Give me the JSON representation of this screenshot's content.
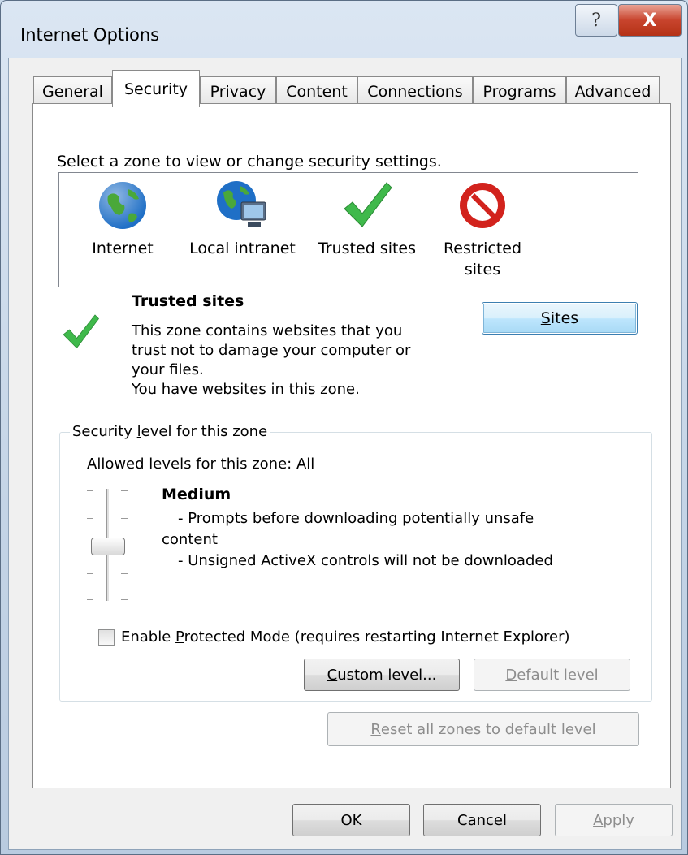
{
  "window": {
    "title": "Internet Options",
    "help_label": "?",
    "close_label": "X"
  },
  "tabs": [
    {
      "label": "General"
    },
    {
      "label": "Security"
    },
    {
      "label": "Privacy"
    },
    {
      "label": "Content"
    },
    {
      "label": "Connections"
    },
    {
      "label": "Programs"
    },
    {
      "label": "Advanced"
    }
  ],
  "active_tab": "Security",
  "zones": {
    "prompt": "Select a zone to view or change security settings.",
    "items": [
      {
        "label_line1": "Internet",
        "label_line2": "",
        "icon": "globe-icon"
      },
      {
        "label_line1": "Local intranet",
        "label_line2": "",
        "icon": "intranet-globe-icon"
      },
      {
        "label_line1": "Trusted sites",
        "label_line2": "",
        "icon": "checkmark-icon"
      },
      {
        "label_line1": "Restricted",
        "label_line2": "sites",
        "icon": "no-entry-icon"
      }
    ]
  },
  "selected_zone": {
    "title": "Trusted sites",
    "desc_line1": "This zone contains websites that you",
    "desc_line2": "trust not to damage your computer or",
    "desc_line3": "your files.",
    "desc_line4": "You have websites in this zone.",
    "sites_button": {
      "prefix": "",
      "underlined": "S",
      "rest": "ites"
    }
  },
  "security_level": {
    "group_title_pre": "Security ",
    "group_title_underlined": "l",
    "group_title_post": "evel for this zone",
    "allowed": "Allowed levels for this zone: All",
    "level_name": "Medium",
    "desc_line1": "- Prompts before downloading potentially unsafe",
    "desc_line2": "content",
    "desc_line3": "- Unsigned ActiveX controls will not be downloaded",
    "slider_position": "Medium"
  },
  "protected_mode": {
    "checked": false,
    "label_pre": "Enable ",
    "label_underlined": "P",
    "label_post": "rotected Mode (requires restarting Internet Explorer)"
  },
  "buttons": {
    "custom_level": {
      "underlined": "C",
      "rest": "ustom level..."
    },
    "default_level": {
      "underlined": "D",
      "rest": "efault level"
    },
    "reset_all": {
      "underlined": "R",
      "rest": "eset all zones to default level"
    },
    "ok": "OK",
    "cancel": "Cancel",
    "apply": {
      "underlined": "A",
      "rest": "pply"
    }
  },
  "colors": {
    "globe_blue": "#1f6fc6",
    "globe_green": "#4aa83a",
    "check_green": "#3fb94b",
    "no_entry_red": "#d2231d",
    "button_focus_blue": "#3c7fb1"
  }
}
